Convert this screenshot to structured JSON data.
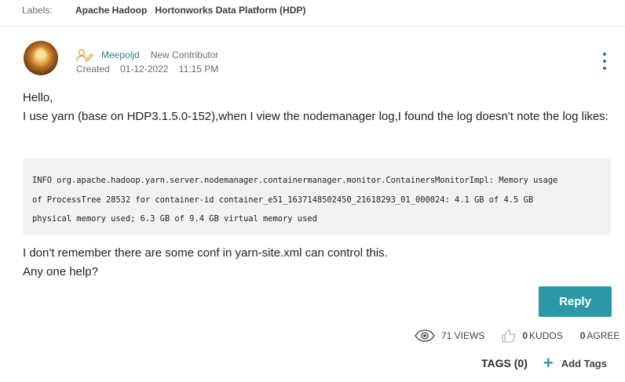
{
  "labels": {
    "caption": "Labels:",
    "items": [
      "Apache Hadoop",
      "Hortonworks Data Platform (HDP)"
    ]
  },
  "author": {
    "name": "Meepoljd",
    "rank": "New Contributor",
    "created_label": "Created",
    "date": "01-12-2022",
    "time": "11:15 PM"
  },
  "body": {
    "line1": "Hello,",
    "line2": "I use yarn (base on HDP3.1.5.0-152),when I view the nodemanager log,I found the log doesn't note the log likes:"
  },
  "code": {
    "lines": [
      "INFO org.apache.hadoop.yarn.server.nodemanager.containermanager.monitor.ContainersMonitorImpl: Memory usage",
      "of ProcessTree 28532 for container-id container_e51_1637148502450_21618293_01_000024: 4.1 GB of 4.5 GB",
      "physical memory used; 6.3 GB of 9.4 GB virtual memory used"
    ]
  },
  "after": {
    "line1": "I don't remember there are some conf in yarn-site.xml can control this.",
    "line2": "Any one help?"
  },
  "reply_label": "Reply",
  "stats": {
    "views": "71 VIEWS",
    "kudos_count": "0",
    "kudos_label": "KUDOS",
    "agree_count": "0",
    "agree_label": "AGREE"
  },
  "tags": {
    "label": "TAGS (0)",
    "add_label": "Add Tags"
  },
  "colors": {
    "accent": "#2c9aa6",
    "author_link": "#2a7f8c",
    "code_bg": "#f2f2f2"
  },
  "icons": [
    "pencil-person-icon",
    "kebab-menu-icon",
    "eye-icon",
    "thumbs-up-icon",
    "plus-icon"
  ]
}
